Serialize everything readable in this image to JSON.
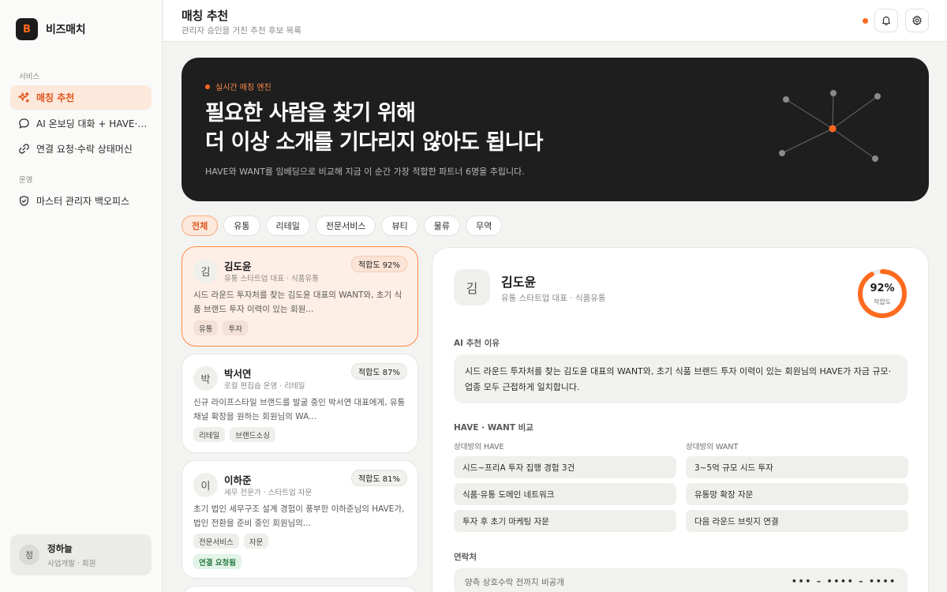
{
  "brand": {
    "logo_letter": "B",
    "name": "비즈매치"
  },
  "sidebar": {
    "sections": [
      {
        "label": "서비스"
      },
      {
        "label": "운영"
      }
    ],
    "items": [
      {
        "label": "매칭 추천",
        "icon": "sparkle-icon",
        "active": true
      },
      {
        "label": "AI 온보딩 대화 + HAVE·WANT 추출",
        "icon": "chat-bubble-icon"
      },
      {
        "label": "연결 요청·수락 상태머신",
        "icon": "link-icon"
      },
      {
        "label": "마스터 관리자 백오피스",
        "icon": "shield-icon"
      }
    ],
    "user": {
      "initial": "정",
      "name": "정하늘",
      "role": "사업개발 · 회원"
    }
  },
  "header": {
    "title": "매칭 추천",
    "subtitle": "관리자 승인을 거친 추천 후보 목록",
    "icons": [
      "bell-icon",
      "gear-icon"
    ],
    "accent": "#ff6a1f"
  },
  "hero": {
    "badge": "실시간 매칭 엔진",
    "title_line1": "필요한 사람을 찾기 위해",
    "title_line2": "더 이상 소개를 기다리지 않아도 됩니다",
    "description": "HAVE와 WANT를 임베딩으로 비교해 지금 이 순간 가장 적합한 파트너 6명을 추립니다."
  },
  "filters": [
    "전체",
    "유통",
    "리테일",
    "전문서비스",
    "뷰티",
    "물류",
    "무역"
  ],
  "active_filter": "전체",
  "candidates": [
    {
      "initial": "김",
      "name": "김도윤",
      "role": "유통 스타트업 대표 · 식품유통",
      "score": "적합도 92%",
      "desc": "시드 라운드 투자처를 찾는 김도윤 대표의 WANT와, 초기 식품 브랜드 투자 이력이 있는 회원...",
      "tags": [
        "유통",
        "투자"
      ],
      "status": ""
    },
    {
      "initial": "박",
      "name": "박서연",
      "role": "로컬 편집숍 운영 · 리테일",
      "score": "적합도 87%",
      "desc": "신규 라이프스타일 브랜드를 발굴 중인 박서연 대표에게, 유통 채널 확장을 원하는 회원님의 WA...",
      "tags": [
        "리테일",
        "브랜드소싱"
      ],
      "status": ""
    },
    {
      "initial": "이",
      "name": "이하준",
      "role": "세무 전문가 · 스타트업 자문",
      "score": "적합도 81%",
      "desc": "초기 법인 세무구조 설계 경험이 풍부한 이하준님의 HAVE가, 법인 전환을 준비 중인 회원님의...",
      "tags": [
        "전문서비스",
        "자문"
      ],
      "status": "연결 요청됨"
    }
  ],
  "detail": {
    "initial": "김",
    "name": "김도윤",
    "role": "유통 스타트업 대표 · 식품유통",
    "score_value": "92%",
    "score_fraction": 0.92,
    "score_caption": "적합도",
    "reason_label": "AI 추천 이유",
    "reason": "시드 라운드 투자처를 찾는 김도윤 대표의 WANT와, 초기 식품 브랜드 투자 이력이 있는 회원님의 HAVE가 자금 규모·업종 모두 근접하게 일치합니다.",
    "compare_label": "HAVE · WANT 비교",
    "have_label": "상대방의 HAVE",
    "want_label": "상대방의 WANT",
    "have": [
      "시드~프리A 투자 집행 경험 3건",
      "식품·유통 도메인 네트워크",
      "투자 후 초기 마케팅 자문"
    ],
    "want": [
      "3~5억 규모 시드 투자",
      "유통망 확장 자문",
      "다음 라운드 브릿지 연결"
    ],
    "contact_label": "연락처",
    "contact_note": "양측 상호수락 전까지 비공개",
    "contact_masked": "••• – •••• – ••••"
  }
}
